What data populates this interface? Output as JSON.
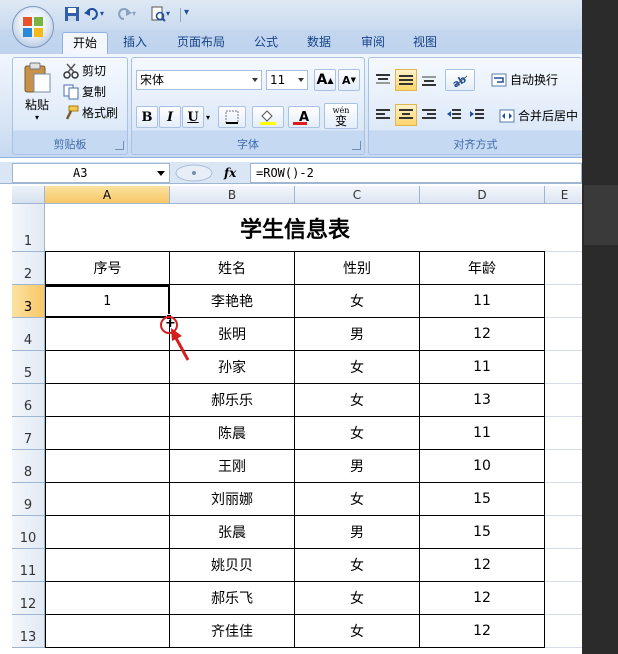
{
  "quick_access": {
    "items": [
      "save-icon",
      "undo-icon",
      "redo-icon",
      "print-preview-icon",
      "customize-icon"
    ]
  },
  "tabs": [
    "开始",
    "插入",
    "页面布局",
    "公式",
    "数据",
    "审阅",
    "视图"
  ],
  "active_tab": "开始",
  "ribbon": {
    "clipboard": {
      "label": "剪贴板",
      "paste": "粘贴",
      "cut": "剪切",
      "copy": "复制",
      "format_painter": "格式刷"
    },
    "font": {
      "label": "字体",
      "font_name": "宋体",
      "font_size": "11",
      "bold": "B",
      "italic": "I",
      "underline": "U",
      "phonetic": "wén",
      "phonetic_char": "变",
      "font_color": "A",
      "grow": "A",
      "shrink": "A"
    },
    "alignment": {
      "label": "对齐方式",
      "wrap_text": "自动换行",
      "merge_center": "合并后居中"
    }
  },
  "formula_bar": {
    "name_box": "A3",
    "fx": "fx",
    "formula": "=ROW()-2"
  },
  "sheet": {
    "columns": [
      "A",
      "B",
      "C",
      "D",
      "E"
    ],
    "selected_column": "A",
    "rows": [
      "1",
      "2",
      "3",
      "4",
      "5",
      "6",
      "7",
      "8",
      "9",
      "10",
      "11",
      "12",
      "13"
    ],
    "selected_row": "3",
    "title": "学生信息表",
    "headers": [
      "序号",
      "姓名",
      "性别",
      "年龄"
    ],
    "records": [
      {
        "seq": "1",
        "name": "李艳艳",
        "gender": "女",
        "age": "11"
      },
      {
        "seq": "",
        "name": "张明",
        "gender": "男",
        "age": "12"
      },
      {
        "seq": "",
        "name": "孙家",
        "gender": "女",
        "age": "11"
      },
      {
        "seq": "",
        "name": "郝乐乐",
        "gender": "女",
        "age": "13"
      },
      {
        "seq": "",
        "name": "陈晨",
        "gender": "女",
        "age": "11"
      },
      {
        "seq": "",
        "name": "王刚",
        "gender": "男",
        "age": "10"
      },
      {
        "seq": "",
        "name": "刘丽娜",
        "gender": "女",
        "age": "15"
      },
      {
        "seq": "",
        "name": "张晨",
        "gender": "男",
        "age": "15"
      },
      {
        "seq": "",
        "name": "姚贝贝",
        "gender": "女",
        "age": "12"
      },
      {
        "seq": "",
        "name": "郝乐飞",
        "gender": "女",
        "age": "12"
      },
      {
        "seq": "",
        "name": "齐佳佳",
        "gender": "女",
        "age": "12"
      }
    ]
  },
  "colors": {
    "annotation": "#d41d1d",
    "selected_header": "#f8c766",
    "ribbon_text": "#15428b"
  }
}
